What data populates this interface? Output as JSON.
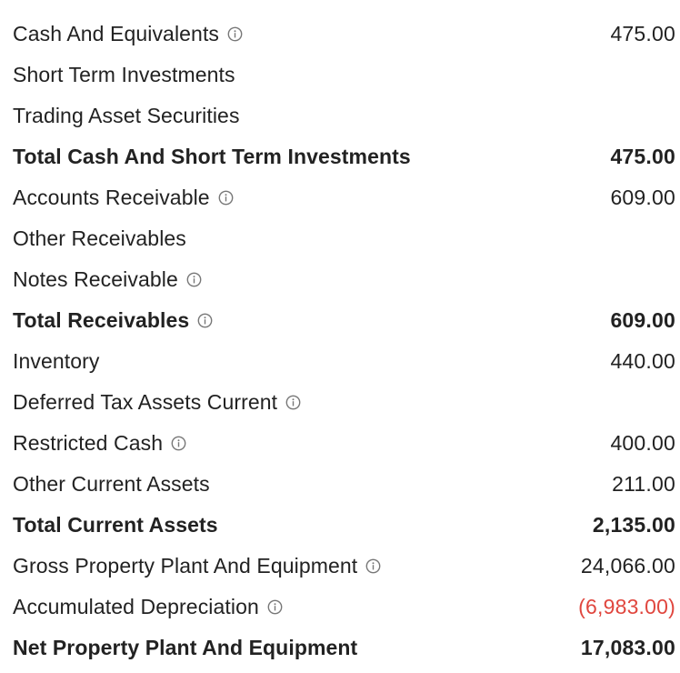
{
  "rows": [
    {
      "label": "Cash And Equivalents",
      "value": "475.00",
      "info": true,
      "total": false,
      "negative": false
    },
    {
      "label": "Short Term Investments",
      "value": "",
      "info": false,
      "total": false,
      "negative": false
    },
    {
      "label": "Trading Asset Securities",
      "value": "",
      "info": false,
      "total": false,
      "negative": false
    },
    {
      "label": "Total Cash And Short Term Investments",
      "value": "475.00",
      "info": false,
      "total": true,
      "negative": false
    },
    {
      "label": "Accounts Receivable",
      "value": "609.00",
      "info": true,
      "total": false,
      "negative": false
    },
    {
      "label": "Other Receivables",
      "value": "",
      "info": false,
      "total": false,
      "negative": false
    },
    {
      "label": "Notes Receivable",
      "value": "",
      "info": true,
      "total": false,
      "negative": false
    },
    {
      "label": "Total Receivables",
      "value": "609.00",
      "info": true,
      "total": true,
      "negative": false
    },
    {
      "label": "Inventory",
      "value": "440.00",
      "info": false,
      "total": false,
      "negative": false
    },
    {
      "label": "Deferred Tax Assets Current",
      "value": "",
      "info": true,
      "total": false,
      "negative": false
    },
    {
      "label": "Restricted Cash",
      "value": "400.00",
      "info": true,
      "total": false,
      "negative": false
    },
    {
      "label": "Other Current Assets",
      "value": "211.00",
      "info": false,
      "total": false,
      "negative": false
    },
    {
      "label": "Total Current Assets",
      "value": "2,135.00",
      "info": false,
      "total": true,
      "negative": false
    },
    {
      "label": "Gross Property Plant And Equipment",
      "value": "24,066.00",
      "info": true,
      "total": false,
      "negative": false
    },
    {
      "label": "Accumulated Depreciation",
      "value": "(6,983.00)",
      "info": true,
      "total": false,
      "negative": true
    },
    {
      "label": "Net Property Plant And Equipment",
      "value": "17,083.00",
      "info": false,
      "total": true,
      "negative": false
    }
  ],
  "colors": {
    "text": "#222222",
    "negative": "#e0463e",
    "info_icon": "#777777"
  },
  "icons": {
    "info": "info-circle-icon"
  }
}
